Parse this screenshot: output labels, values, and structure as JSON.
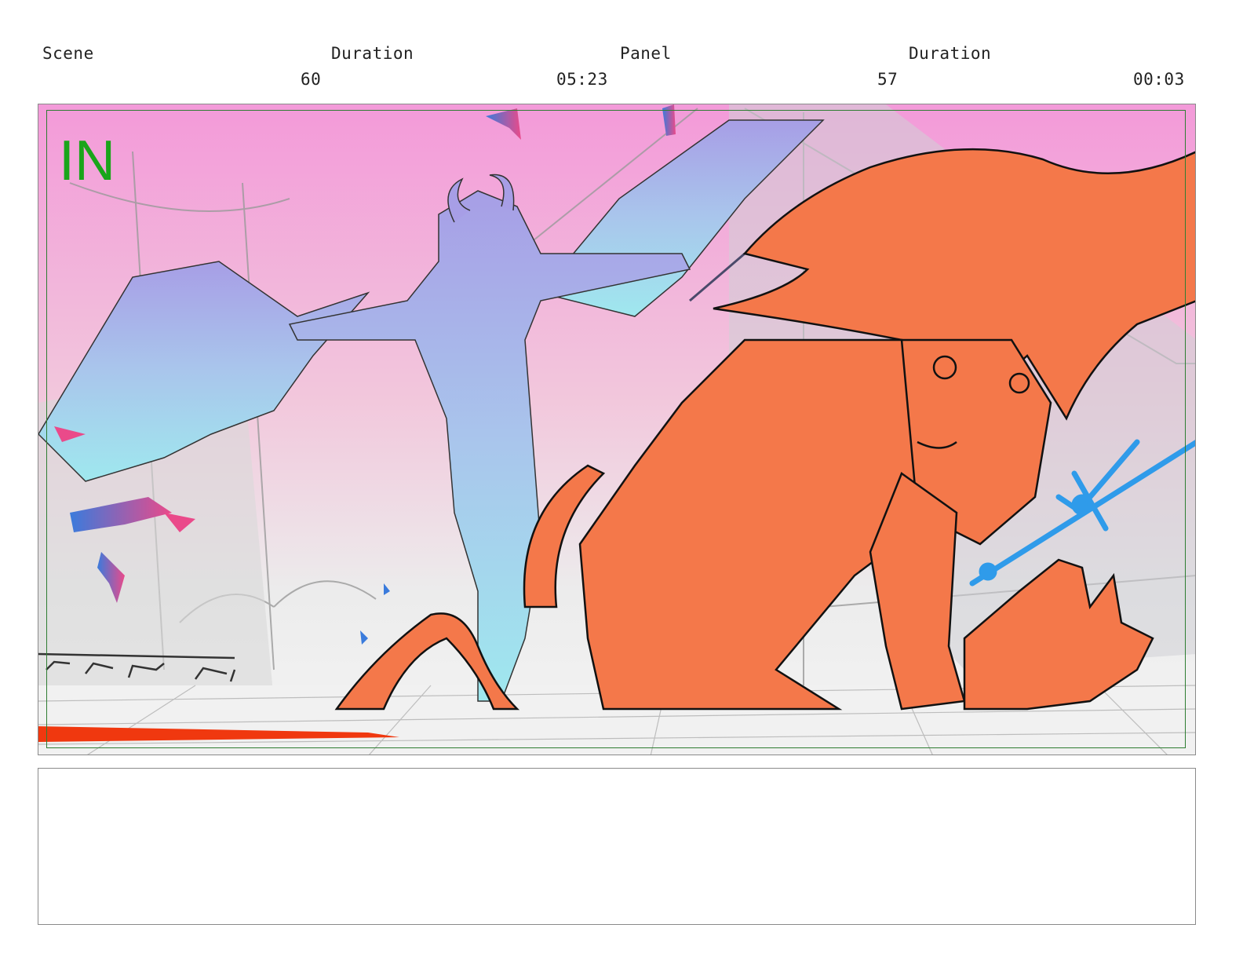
{
  "header": {
    "scene_label": "Scene",
    "scene_duration_label": "Duration",
    "panel_label": "Panel",
    "panel_duration_label": "Duration",
    "scene_value": "60",
    "scene_duration_value": "05:23",
    "panel_value": "57",
    "panel_duration_value": "00:03"
  },
  "panel": {
    "transition_label": "IN"
  },
  "colors": {
    "safe_frame": "#2e7d32",
    "transition_text": "#1aa51a",
    "character_fill": "#f4784a",
    "demon_gradient_top": "#a79ee6",
    "demon_gradient_bottom": "#9fe8ee",
    "trident": "#2f9bea",
    "sky_top": "#f39ad9"
  },
  "notes": {
    "text": ""
  }
}
